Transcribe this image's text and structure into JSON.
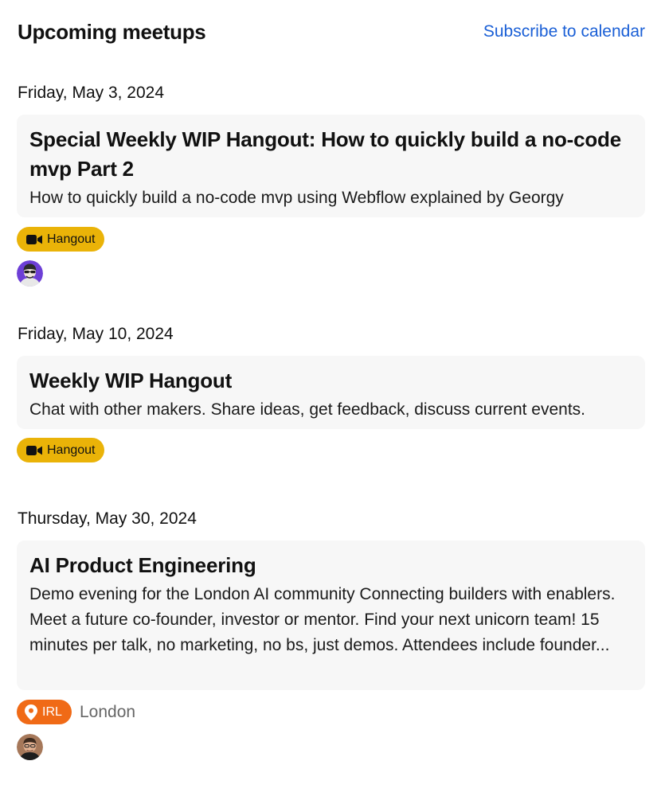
{
  "header": {
    "title": "Upcoming meetups",
    "subscribe_label": "Subscribe to calendar"
  },
  "events": [
    {
      "date": "Friday, May 3, 2024",
      "title": "Special Weekly WIP Hangout: How to quickly build a no-code mvp Part 2",
      "description": "How to quickly build a no-code mvp using Webflow explained by Georgy",
      "badge": {
        "label": "Hangout",
        "icon": "video-camera-icon",
        "color": "#eab308"
      },
      "location": "",
      "attendee_avatar": "attendee-avatar"
    },
    {
      "date": "Friday, May 10, 2024",
      "title": "Weekly WIP Hangout",
      "description": "Chat with other makers. Share ideas, get feedback, discuss current events.",
      "badge": {
        "label": "Hangout",
        "icon": "video-camera-icon",
        "color": "#eab308"
      },
      "location": "",
      "attendee_avatar": ""
    },
    {
      "date": "Thursday, May 30, 2024",
      "title": "AI Product Engineering",
      "description": "Demo evening for the London AI community Connecting builders with enablers. Meet a future co-founder, investor or mentor. Find your next unicorn team! 15 minutes per talk, no marketing, no bs, just demos. Attendees include founder...",
      "badge": {
        "label": "IRL",
        "icon": "map-pin-icon",
        "color": "#f06a16"
      },
      "location": "London",
      "attendee_avatar": "attendee-avatar"
    }
  ],
  "colors": {
    "link": "#1a5fd6",
    "card_background": "#f7f7f7",
    "hangout_badge": "#eab308",
    "irl_badge": "#f06a16"
  }
}
